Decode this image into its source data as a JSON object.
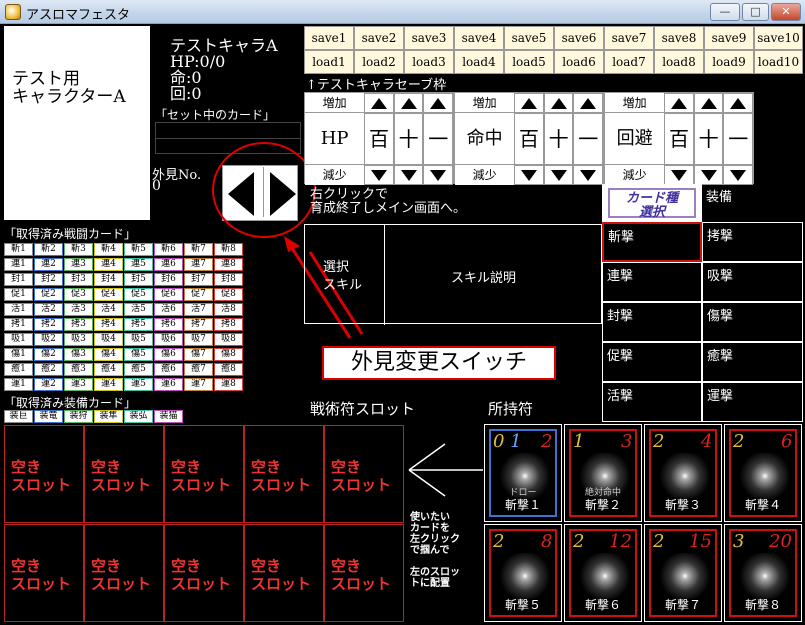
{
  "window": {
    "title": "アスロマフェスタ",
    "min_label": "—",
    "max_label": "□",
    "close_label": "✕"
  },
  "preview": {
    "name_line1": "テスト用",
    "name_line2": "キャラクターA"
  },
  "char_info": {
    "name": "テストキャラA",
    "hp": "HP:0/0",
    "life": "命:0",
    "evade": "回:0",
    "set_cards_label": "「セット中のカード」"
  },
  "appearance": {
    "label": "外見No.",
    "value": "0",
    "annotation": "外見変更スイッチ"
  },
  "save_slots": [
    "save1",
    "save2",
    "save3",
    "save4",
    "save5",
    "save6",
    "save7",
    "save8",
    "save9",
    "save10"
  ],
  "load_slots": [
    "load1",
    "load2",
    "load3",
    "load4",
    "load5",
    "load6",
    "load7",
    "load8",
    "load9",
    "load10"
  ],
  "save_caption": "↑テストキャラセーブ枠",
  "stat_groups": [
    {
      "increase": "増加",
      "stat": "HP",
      "decrease": "減少",
      "hundred": "百",
      "ten": "十",
      "one": "一"
    },
    {
      "increase": "増加",
      "stat": "命中",
      "decrease": "減少",
      "hundred": "百",
      "ten": "十",
      "one": "一"
    },
    {
      "increase": "増加",
      "stat": "回避",
      "decrease": "減少",
      "hundred": "百",
      "ten": "十",
      "one": "一"
    }
  ],
  "info_text_line1": "右クリックで",
  "info_text_line2": "育成終了しメイン画面へ。",
  "card_type_button": "カード種\n選択",
  "equip_label": "装備",
  "categories_left": [
    "斬撃",
    "連撃",
    "封撃",
    "促撃",
    "活撃"
  ],
  "categories_right": [
    "拷撃",
    "吸撃",
    "傷撃",
    "癒撃",
    "運撃"
  ],
  "skill_select_label": "選択\nスキル",
  "skill_desc_label": "スキル説明",
  "tactic_cards_title": "「取得済み戦闘カード」",
  "tactic_grid": [
    [
      "斬1",
      "斬2",
      "斬3",
      "斬4",
      "斬5",
      "斬6",
      "斬7",
      "斬8"
    ],
    [
      "連1",
      "連2",
      "連3",
      "連4",
      "連5",
      "連6",
      "連7",
      "連8"
    ],
    [
      "封1",
      "封2",
      "封3",
      "封4",
      "封5",
      "封6",
      "封7",
      "封8"
    ],
    [
      "促1",
      "促2",
      "促3",
      "促4",
      "促5",
      "促6",
      "促7",
      "促8"
    ],
    [
      "活1",
      "活2",
      "活3",
      "活4",
      "活5",
      "活6",
      "活7",
      "活8"
    ],
    [
      "拷1",
      "拷2",
      "拷3",
      "拷4",
      "拷5",
      "拷6",
      "拷7",
      "拷8"
    ],
    [
      "吸1",
      "吸2",
      "吸3",
      "吸4",
      "吸5",
      "吸6",
      "吸7",
      "吸8"
    ],
    [
      "傷1",
      "傷2",
      "傷3",
      "傷4",
      "傷5",
      "傷6",
      "傷7",
      "傷8"
    ],
    [
      "癒1",
      "癒2",
      "癒3",
      "癒4",
      "癒5",
      "癒6",
      "癒7",
      "癒8"
    ],
    [
      "運1",
      "運2",
      "運3",
      "運4",
      "運5",
      "運6",
      "運7",
      "運8"
    ]
  ],
  "equip_cards_title": "「取得済み装備カード」",
  "equip_grid": [
    "装巨",
    "装竜",
    "装狩",
    "装隼",
    "装弘",
    "装猫"
  ],
  "slot_title": "戦術符スロット",
  "owned_title": "所持符",
  "empty_slot_text_line1": "空き",
  "empty_slot_text_line2": "スロット",
  "hint_text": "使いたい\nカードを\n左クリック\nで掴んで\n\n左のスロッ\nトに配置",
  "owned_cards": [
    {
      "n1": "0",
      "n2": "1",
      "n3": "2",
      "name": "斬撃１",
      "sub": "ドロー"
    },
    {
      "n1": "1",
      "n2": "",
      "n3": "3",
      "name": "斬撃２",
      "sub": "絶対命中"
    },
    {
      "n1": "2",
      "n2": "",
      "n3": "4",
      "name": "斬撃３",
      "sub": ""
    },
    {
      "n1": "2",
      "n2": "",
      "n3": "6",
      "name": "斬撃４",
      "sub": ""
    },
    {
      "n1": "2",
      "n2": "",
      "n3": "8",
      "name": "斬撃５",
      "sub": ""
    },
    {
      "n1": "2",
      "n2": "",
      "n3": "12",
      "name": "斬撃６",
      "sub": ""
    },
    {
      "n1": "2",
      "n2": "",
      "n3": "15",
      "name": "斬撃７",
      "sub": ""
    },
    {
      "n1": "3",
      "n2": "",
      "n3": "20",
      "name": "斬撃８",
      "sub": ""
    }
  ],
  "colors": {
    "accent_red": "#e02020",
    "save_bg": "#fff8dc",
    "card_type_border": "#9a80c0"
  }
}
